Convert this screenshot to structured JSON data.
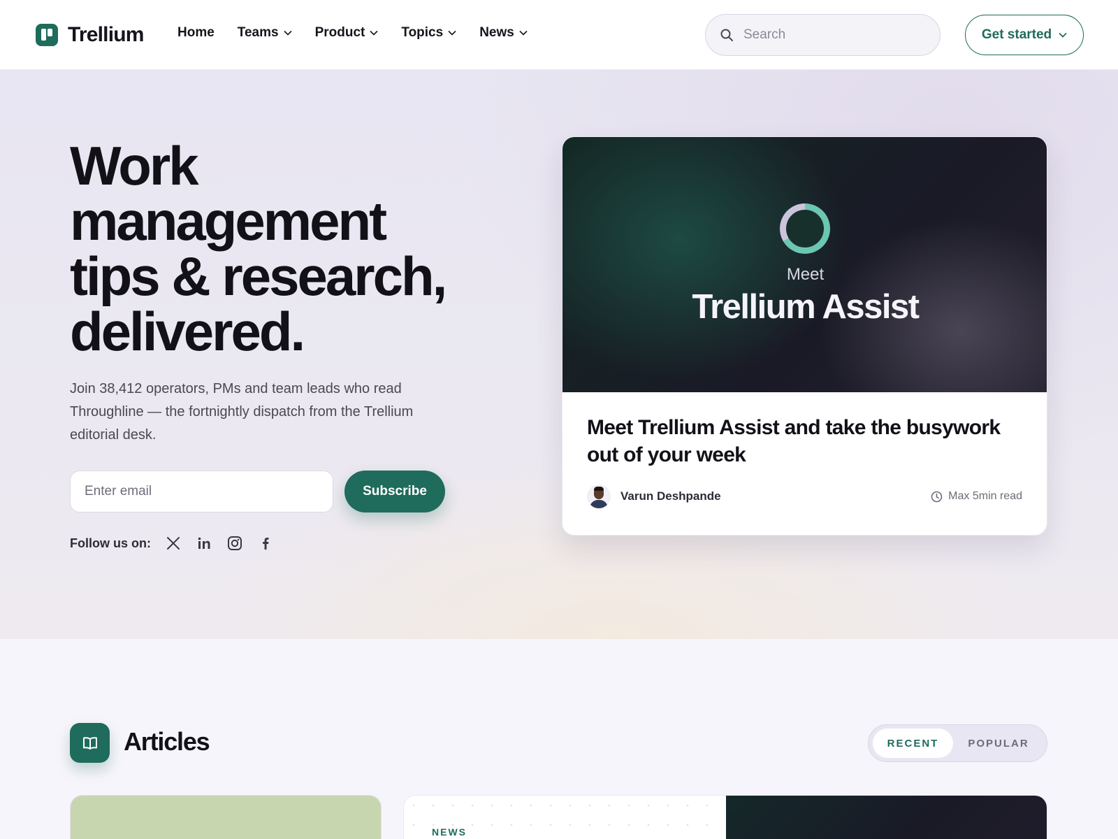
{
  "header": {
    "brand": "Trellium",
    "nav": [
      "Home",
      "Teams",
      "Product",
      "Topics",
      "News"
    ],
    "search_placeholder": "Search",
    "cta": "Get started"
  },
  "hero": {
    "title": "Work management tips & research, delivered.",
    "subtitle": "Join 38,412 operators, PMs and team leads who read Throughline — the fortnightly dispatch from the Trellium editorial desk.",
    "email_placeholder": "Enter email",
    "subscribe_label": "Subscribe",
    "follow_label": "Follow us on:",
    "social_icons": [
      "x-icon",
      "linkedin-icon",
      "instagram-icon",
      "facebook-icon"
    ]
  },
  "feature": {
    "kicker": "Meet",
    "image_title": "Trellium Assist",
    "headline": "Meet Trellium Assist and take the busywork out of your week",
    "author": "Varun Deshpande",
    "read_time": "Max 5min read"
  },
  "articles": {
    "title": "Articles",
    "tabs": [
      "RECENT",
      "POPULAR"
    ],
    "active_tab": "RECENT",
    "card_kicker": "NEWS"
  },
  "colors": {
    "brand": "#1f6b5c",
    "text": "#15141c",
    "hero_bg": "#e8e6f2"
  }
}
